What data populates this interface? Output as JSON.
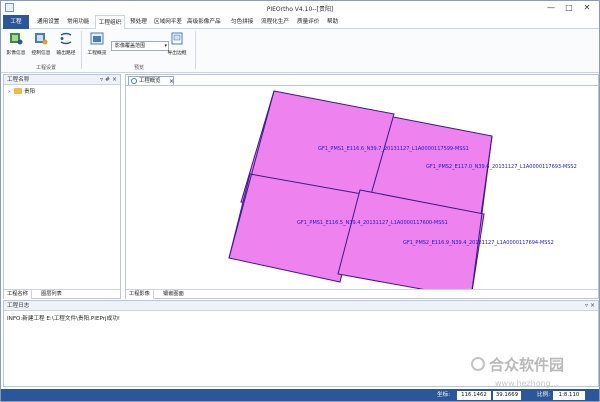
{
  "window": {
    "title": "PIEOrtho V4.10--[贵阳]",
    "minimize": "—",
    "maximize": "□",
    "close": "✕"
  },
  "menu": {
    "items": [
      {
        "label": "工程",
        "active": true
      },
      {
        "label": "通用设置"
      },
      {
        "label": "常用功能"
      },
      {
        "label": "工程组织",
        "open": true
      },
      {
        "label": "预处理"
      },
      {
        "label": "区域网平差"
      },
      {
        "label": "高级影像产品"
      },
      {
        "label": "匀色拼接"
      },
      {
        "label": "流程化生产"
      },
      {
        "label": "质量评价"
      },
      {
        "label": "帮助"
      }
    ]
  },
  "ribbon": {
    "buttons": [
      {
        "label": "影像信息",
        "icon": "image-info-icon"
      },
      {
        "label": "控制信息",
        "icon": "control-info-icon"
      },
      {
        "label": "输出路径",
        "icon": "output-path-icon"
      },
      {
        "label": "工程概览",
        "icon": "project-overview-icon"
      },
      {
        "label": "导出边框",
        "icon": "export-border-icon"
      }
    ],
    "groups": {
      "project_settings": "工程设置",
      "preview": "预览"
    },
    "combo_value": "影像覆盖范围"
  },
  "left_pane": {
    "title": "工程名称",
    "pin": "▿ # ×",
    "tree_item": "贵阳",
    "tabs": [
      "工程名称",
      "图层列表"
    ]
  },
  "map_pane": {
    "doc_tab": "工程概览",
    "doc_tab_close": "×",
    "tabs": [
      "工程影像",
      "镶嵌图面"
    ],
    "labels": [
      "GF1_PMS1_E116.6_N39.7_20131127_L1A0000117599-MSS1",
      "GF1_PMS2_E117.0_N39.6_20131127_L1A0000117693-MSS2",
      "GF1_PMS1_E116.5_N39.4_20131127_L1A0000117600-MSS1",
      "GF1_PMS2_E116.9_N39.4_20131127_L1A0000117694-MSS2"
    ],
    "fill_color": "#ee82ee",
    "outline_color": "#3a1a8a",
    "label_color": "#1a1acc"
  },
  "log_pane": {
    "title": "工程日志",
    "pin": "▿ ×",
    "message": "INFO:新建工程 E:\\工程文件\\贵阳.PIEPrj成功!"
  },
  "status": {
    "coord_label": "坐标:",
    "x": "116.1462",
    "y": "39.1669",
    "scale_label": "比例:",
    "scale": "1:8.110"
  },
  "watermark": {
    "text": "合众软件园",
    "url": "www.hezhong..."
  }
}
